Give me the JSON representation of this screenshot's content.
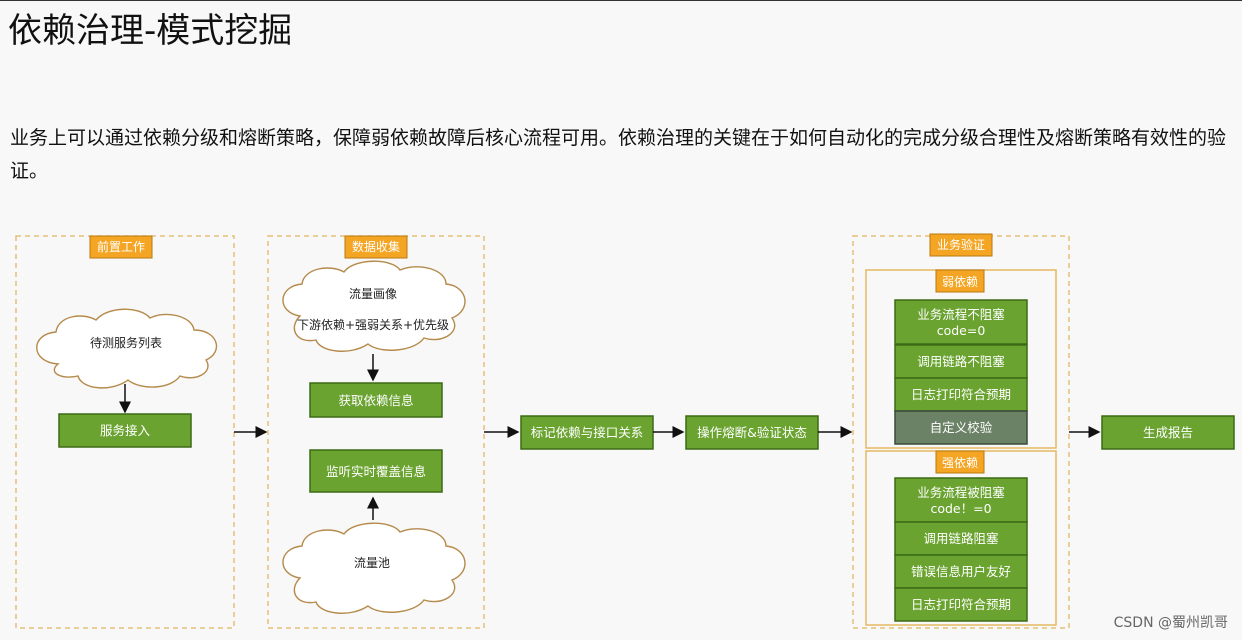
{
  "title": "依赖治理-模式挖掘",
  "description": "业务上可以通过依赖分级和熔断策略，保障弱依赖故障后核心流程可用。依赖治理的关键在于如何自动化的完成分级合理性及熔断策略有效性的验证。",
  "watermark": "CSDN @蜀州凯哥",
  "sections": {
    "prep": {
      "label": "前置工作",
      "cloud": "待测服务列表",
      "box": "服务接入"
    },
    "collect": {
      "label": "数据收集",
      "cloud_title": "流量画像",
      "cloud_sub": "下游依赖+强弱关系+优先级",
      "box_get": "获取依赖信息",
      "box_listen": "监听实时覆盖信息",
      "cloud_pool": "流量池"
    },
    "mark": "标记依赖与接口关系",
    "operate": "操作熔断&验证状态",
    "verify": {
      "label": "业务验证",
      "weak": {
        "label": "弱依赖",
        "items": [
          "业务流程不阻塞",
          "code=0",
          "调用链路不阻塞",
          "日志打印符合预期",
          "自定义校验"
        ]
      },
      "strong": {
        "label": "强依赖",
        "items": [
          "业务流程被阻塞",
          "code！=0",
          "调用链路阻塞",
          "错误信息用户友好",
          "日志打印符合预期"
        ]
      }
    },
    "report": "生成报告"
  }
}
